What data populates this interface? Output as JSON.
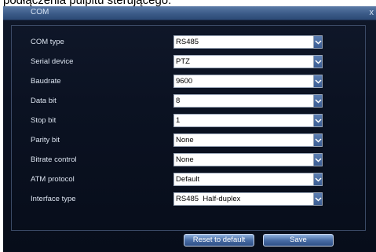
{
  "page_caption": "podłączenia pulpitu sterującego:",
  "window": {
    "title": "COM",
    "close_glyph": "x"
  },
  "fields": [
    {
      "label": "COM type",
      "value": "RS485"
    },
    {
      "label": "Serial device",
      "value": "PTZ"
    },
    {
      "label": "Baudrate",
      "value": "9600"
    },
    {
      "label": "Data bit",
      "value": "8"
    },
    {
      "label": "Stop bit",
      "value": "1"
    },
    {
      "label": "Parity bit",
      "value": "None"
    },
    {
      "label": "Bitrate control",
      "value": "None"
    },
    {
      "label": "ATM protocol",
      "value": "Default"
    },
    {
      "label": "Interface type",
      "value": "RS485  Half-duplex"
    }
  ],
  "buttons": {
    "reset": "Reset to default",
    "save": "Save"
  },
  "icons": {
    "dropdown": "chevron-down-icon",
    "close": "close-icon"
  },
  "colors": {
    "dialog_bg": "#0b1222",
    "titlebar": "#3b5b88",
    "button": "#4a6ea6"
  }
}
